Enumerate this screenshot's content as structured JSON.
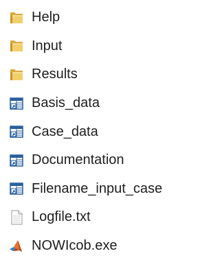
{
  "colors": {
    "folder_body": "#e8c25a",
    "folder_back": "#d9a93a",
    "shortcut_blue": "#1f5fa8",
    "text": "#1e1e1e"
  },
  "files": [
    {
      "name": "Help",
      "icon": "folder-icon",
      "type": "folder"
    },
    {
      "name": "Input",
      "icon": "folder-icon",
      "type": "folder"
    },
    {
      "name": "Results",
      "icon": "folder-icon",
      "type": "folder"
    },
    {
      "name": "Basis_data",
      "icon": "database-shortcut-icon",
      "type": "shortcut"
    },
    {
      "name": "Case_data",
      "icon": "database-shortcut-icon",
      "type": "shortcut"
    },
    {
      "name": "Documentation",
      "icon": "database-shortcut-icon",
      "type": "shortcut"
    },
    {
      "name": "Filename_input_case",
      "icon": "database-shortcut-icon",
      "type": "shortcut"
    },
    {
      "name": "Logfile.txt",
      "icon": "text-file-icon",
      "type": "file"
    },
    {
      "name": "NOWIcob.exe",
      "icon": "matlab-icon",
      "type": "executable"
    }
  ]
}
